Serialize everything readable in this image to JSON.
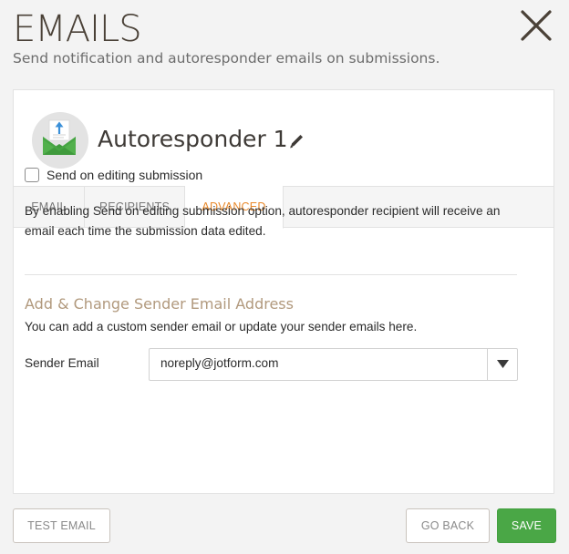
{
  "page": {
    "title": "EMAILS",
    "subtitle": "Send notification and autoresponder emails on submissions."
  },
  "header": {
    "autoresponder_name": "Autoresponder 1"
  },
  "tabs": [
    {
      "label": "EMAIL",
      "active": false
    },
    {
      "label": "RECIPIENTS",
      "active": false
    },
    {
      "label": "ADVANCED",
      "active": true
    }
  ],
  "advanced": {
    "checkbox_label": "Send on editing submission",
    "checkbox_checked": false,
    "description": "By enabling Send on editing submission option, autoresponder recipient will receive an email each time the submission data edited.",
    "sender_section_title": "Add & Change Sender Email Address",
    "sender_section_desc": "You can add a custom sender email or update your sender emails here.",
    "sender_label": "Sender Email",
    "sender_value": "noreply@jotform.com"
  },
  "footer": {
    "test_email_label": "TEST EMAIL",
    "go_back_label": "GO BACK",
    "save_label": "SAVE"
  },
  "colors": {
    "accent_tab": "#e8892c",
    "section_title": "#b1997d",
    "save_button": "#4aa746",
    "envelope": "#52b04c",
    "upload_arrow": "#3a8fd8"
  },
  "icons": {
    "close": "close-icon",
    "avatar": "envelope-upload-icon",
    "edit": "pencil-icon",
    "dropdown": "caret-down-icon"
  }
}
